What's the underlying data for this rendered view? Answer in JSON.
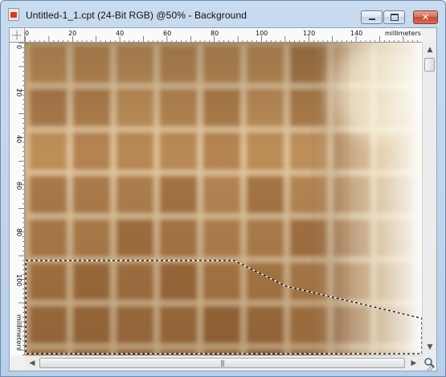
{
  "window": {
    "title": "Untitled-1_1.cpt (24-Bit RGB) @50% - Background",
    "icon": "corel-document-icon",
    "controls": {
      "minimize": "minimize-icon",
      "maximize": "maximize-icon",
      "close": "✕"
    }
  },
  "rulers": {
    "unit": "millimeters",
    "horizontal_ticks": [
      "0",
      "20",
      "40",
      "60",
      "80",
      "100",
      "120",
      "140"
    ],
    "vertical_ticks": [
      "0",
      "20",
      "40",
      "60",
      "80",
      "100"
    ],
    "corner": "origin-icon"
  },
  "scrollbars": {
    "up": "▲",
    "down": "▼",
    "left": "◀",
    "right": "▶",
    "grip": "|||"
  },
  "canvas": {
    "description_colors": {
      "tile_dark": "#9d6a3c",
      "tile_light": "#c99a62",
      "grout": "#e8cda4",
      "highlight": "#fffbe8"
    }
  }
}
